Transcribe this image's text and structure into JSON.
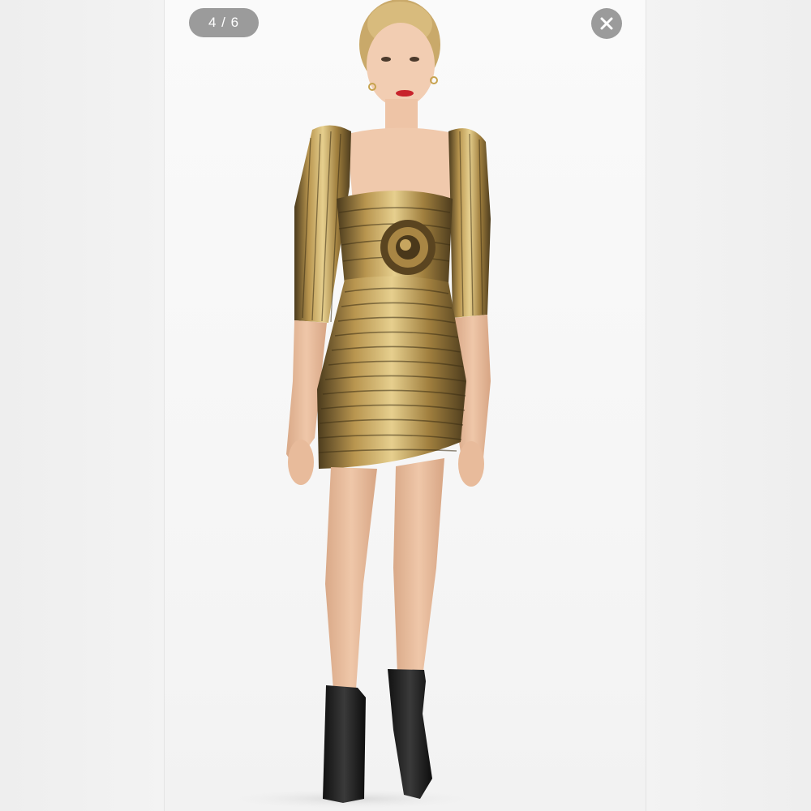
{
  "viewer": {
    "counter": "4 / 6",
    "current_index": 4,
    "total": 6
  },
  "close_button": {
    "icon": "close-icon"
  },
  "photo": {
    "subject": "product-photo"
  },
  "colors": {
    "pill_background": "#9b9b9b",
    "pill_text": "#ffffff",
    "page_background": "#f1f1f1"
  }
}
